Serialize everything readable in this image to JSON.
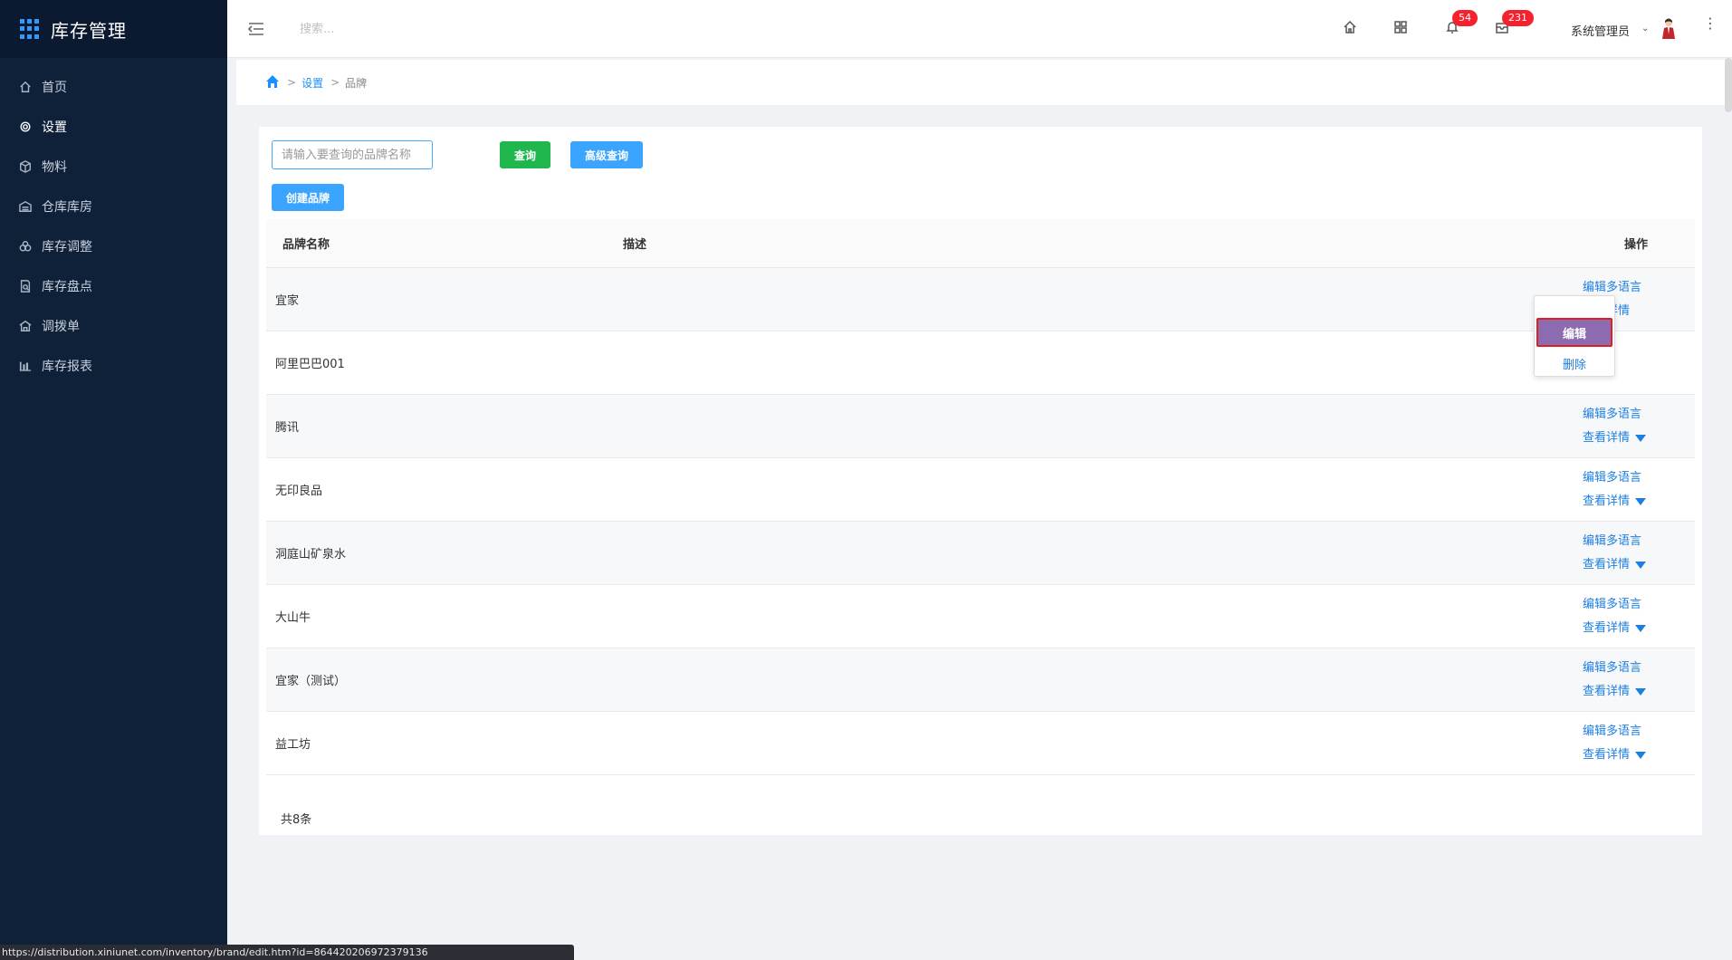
{
  "app": {
    "title": "库存管理"
  },
  "sidebar": {
    "items": [
      {
        "label": "首页",
        "icon": "home-icon"
      },
      {
        "label": "设置",
        "icon": "gear-icon",
        "active": true
      },
      {
        "label": "物料",
        "icon": "cube-icon"
      },
      {
        "label": "仓库库房",
        "icon": "warehouse-icon"
      },
      {
        "label": "库存调整",
        "icon": "adjust-icon"
      },
      {
        "label": "库存盘点",
        "icon": "inventory-check-icon"
      },
      {
        "label": "调拨单",
        "icon": "transfer-icon"
      },
      {
        "label": "库存报表",
        "icon": "bar-chart-icon"
      }
    ]
  },
  "header": {
    "search_placeholder": "搜索...",
    "notification_count": "54",
    "message_count": "231",
    "user_name": "系统管理员"
  },
  "breadcrumb": {
    "level1": "设置",
    "level2": "品牌"
  },
  "toolbar": {
    "query_placeholder": "请输入要查询的品牌名称",
    "query_label": "查询",
    "advanced_label": "高级查询",
    "create_label": "创建品牌"
  },
  "table": {
    "headers": {
      "name": "品牌名称",
      "desc": "描述",
      "op": "操作"
    },
    "rows": [
      {
        "name": "宜家",
        "desc": ""
      },
      {
        "name": "阿里巴巴001",
        "desc": ""
      },
      {
        "name": "腾讯",
        "desc": ""
      },
      {
        "name": "无印良品",
        "desc": ""
      },
      {
        "name": "洞庭山矿泉水",
        "desc": ""
      },
      {
        "name": "大山牛",
        "desc": ""
      },
      {
        "name": "宜家（测试）",
        "desc": ""
      },
      {
        "name": "益工坊",
        "desc": ""
      }
    ],
    "op_edit_lang": "编辑多语言",
    "op_view": "查看详情",
    "total": "共8条"
  },
  "dropdown": {
    "edit": "编辑",
    "delete": "删除"
  },
  "statusbar": {
    "url": "https://distribution.xiniunet.com/inventory/brand/edit.htm?id=864420206972379136"
  },
  "colors": {
    "sidebar_bg": "#0f2039",
    "accent": "#1890ff",
    "query_green": "#1fb64e",
    "badge_red": "#f5222d"
  }
}
